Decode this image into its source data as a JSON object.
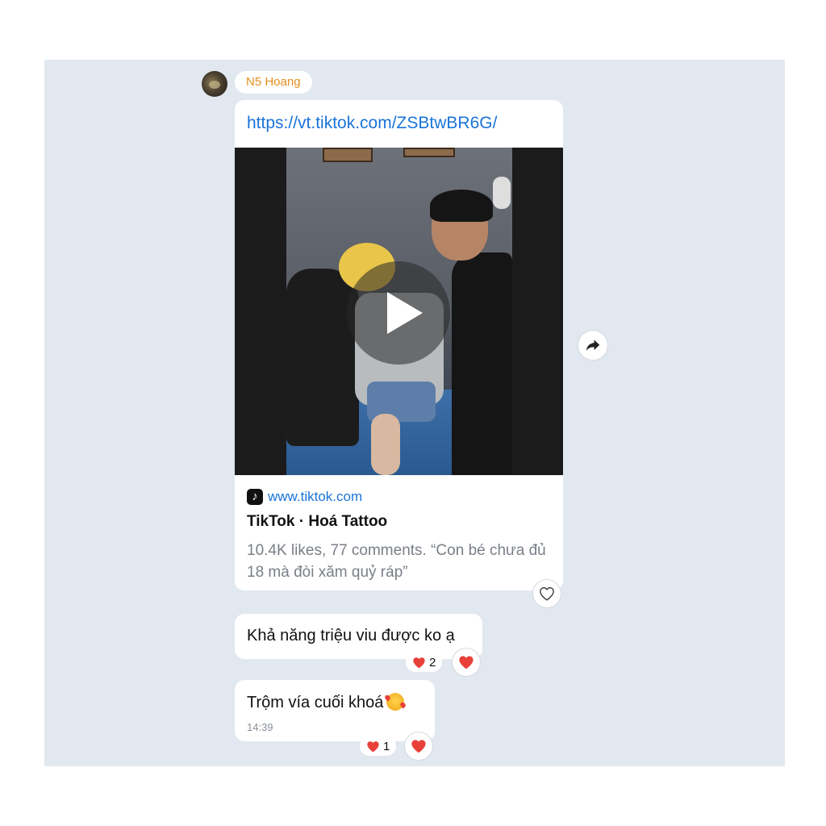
{
  "message": {
    "sender_name": "N5 Hoang",
    "link_preview": {
      "url": "https://vt.tiktok.com/ZSBtwBR6G/",
      "source_domain": "www.tiktok.com",
      "title": "TikTok · Hoá Tattoo",
      "description": "10.4K likes, 77 comments. “Con bé chưa đủ 18 mà đòi xăm quỷ ráp”"
    }
  },
  "replies": [
    {
      "text": "Khả năng triệu viu được ko ạ",
      "reaction_count": "2"
    },
    {
      "text": "Trộm vía cuối khoá",
      "time": "14:39",
      "reaction_count": "1"
    }
  ],
  "icons": {
    "heart": "heart-icon",
    "heart_outline": "heart-outline-icon",
    "share": "share-arrow-icon",
    "play": "play-icon",
    "tiktok": "tiktok-icon",
    "emoji": "smiling-face-with-hearts-icon"
  },
  "colors": {
    "chat_background": "#e2e8f0",
    "sender_name": "#e48f1c",
    "link": "#1a73d9",
    "reaction_heart": "#e8413a"
  }
}
